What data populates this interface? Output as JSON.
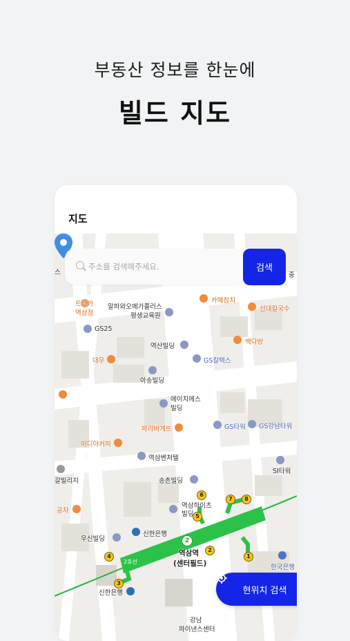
{
  "hero": {
    "subtitle": "부동산 정보를 한눈에",
    "title": "빌드 지도"
  },
  "card": {
    "title": "지도"
  },
  "search": {
    "placeholder": "주소를 검색해주세요.",
    "button_label": "검색"
  },
  "location_button": {
    "label": "현위치 검색"
  },
  "map": {
    "labels": {
      "trager": "트라가",
      "trager2": "역삼점",
      "alpha": "알파와오메가플러스",
      "alpha2": "평생교육원",
      "cafe": "카예참치",
      "sundae": "선대칼국수",
      "gs25": "GS25",
      "yeoksan": "역산빌딩",
      "baek": "백다방",
      "daewoo": "대우",
      "gscaltex": "GS칼텍스",
      "asung": "아송빌딩",
      "hs": "에이치에스",
      "hs2": "빌딩",
      "paris": "파리바게뜨",
      "gstower": "GS타워",
      "gsgangnam": "GS강남타워",
      "idiya": "이디야커피",
      "venture": "역삼벤처텔",
      "village": "갈빌리지",
      "si": "SI타워",
      "songchon": "송촌빌딩",
      "gongcha": "공차",
      "yeoksamh": "역삼하이츠",
      "yeoksamh2": "빌딩",
      "shinhan1": "신한은행",
      "woosin": "우신빌딩",
      "station": "역삼역",
      "station2": "(센터필드)",
      "hankook": "한국은행",
      "shinhan2": "신한은행",
      "finance": "강남",
      "finance2": "파이낸스센터",
      "edge_left": "스",
      "edge_right": "중"
    },
    "exits": [
      "1",
      "2",
      "3",
      "4",
      "5",
      "6",
      "7",
      "8"
    ],
    "line_number": "2",
    "line_label": "2호선"
  }
}
